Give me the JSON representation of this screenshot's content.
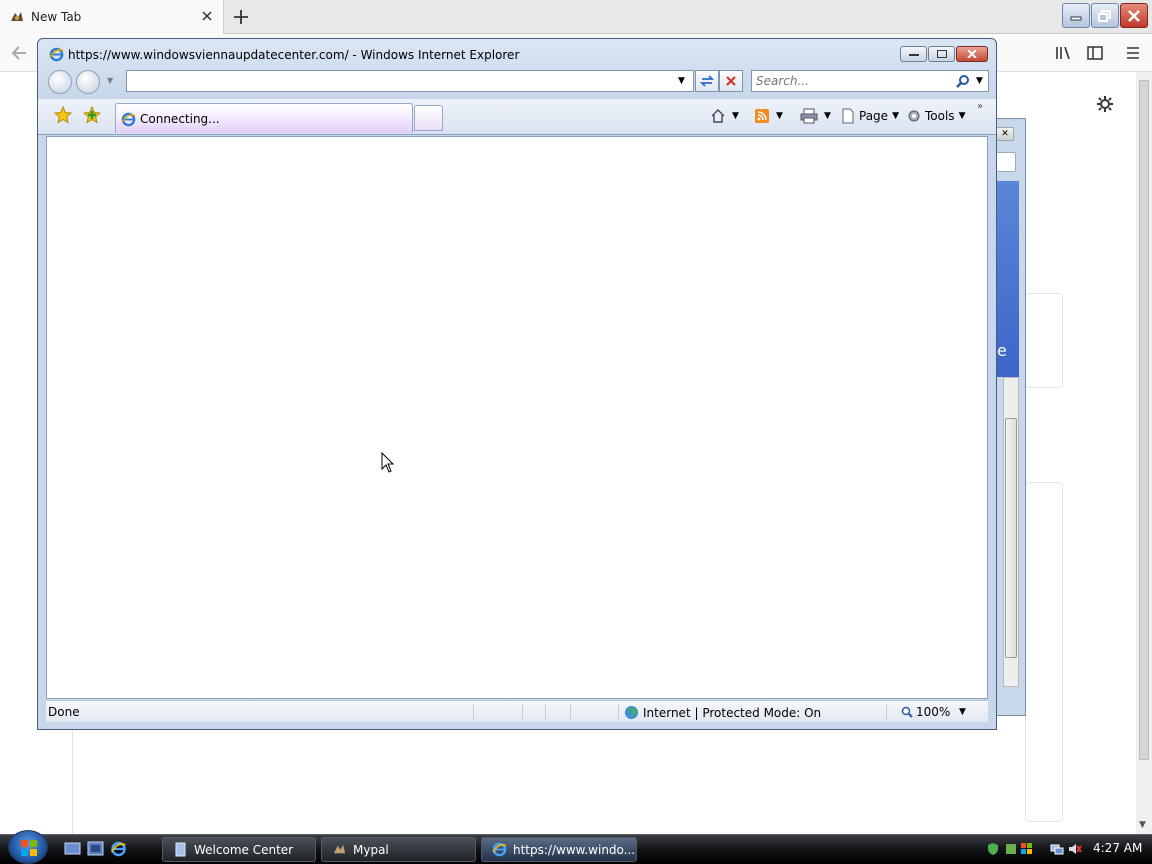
{
  "bg_browser": {
    "tab_title": "New Tab"
  },
  "ie": {
    "window_title": "https://www.windowsviennaupdatecenter.com/ - Windows Internet Explorer",
    "address_value": "",
    "search_placeholder": "Search...",
    "tab_label": "Connecting...",
    "cmd": {
      "page_label": "Page",
      "tools_label": "Tools"
    },
    "status": {
      "text": "Done",
      "zone": "Internet | Protected Mode: On",
      "zoom": "100%"
    }
  },
  "behind_window": {
    "partial_text": "e"
  },
  "taskbar": {
    "buttons": [
      {
        "label": "Welcome Center"
      },
      {
        "label": "Mypal"
      },
      {
        "label": "https://www.windo..."
      }
    ],
    "clock": "4:27 AM"
  },
  "colors": {
    "ie_frame": "#c7d6ea",
    "tab_active": "#e3cff6",
    "taskbar": "#111316",
    "close_red": "#c44936"
  }
}
